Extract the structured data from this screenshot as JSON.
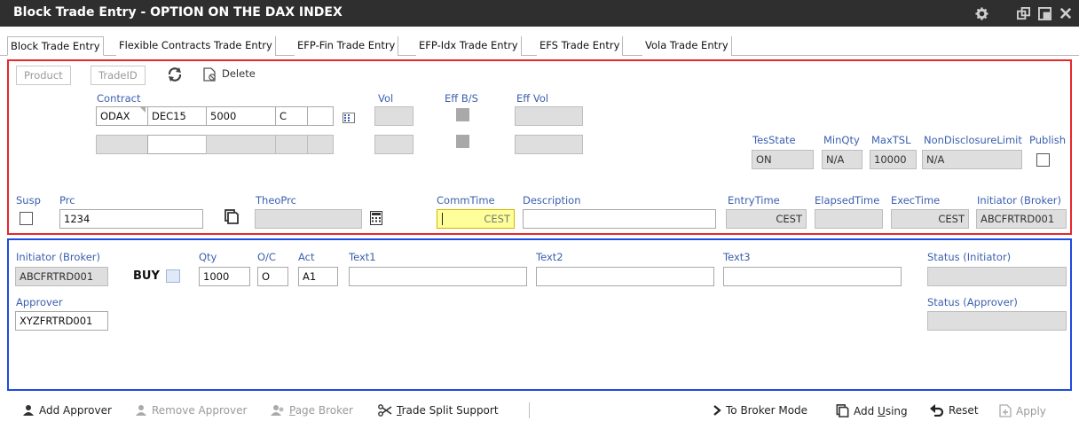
{
  "window": {
    "title": "Block Trade Entry - OPTION ON THE DAX INDEX",
    "icons": [
      "gear-icon",
      "restore-icon",
      "maximize-icon",
      "close-icon"
    ]
  },
  "tabs": [
    {
      "label": "Block Trade Entry",
      "active": true
    },
    {
      "label": "Flexible Contracts Trade Entry",
      "active": false
    },
    {
      "label": "EFP-Fin Trade Entry",
      "active": false
    },
    {
      "label": "EFP-Idx Trade Entry",
      "active": false
    },
    {
      "label": "EFS Trade Entry",
      "active": false
    },
    {
      "label": "Vola Trade Entry",
      "active": false
    }
  ],
  "header_section": {
    "product_btn": "Product",
    "tradeid_btn": "TradeID",
    "delete_btn": "Delete",
    "contract_label": "Contract",
    "contract": {
      "product": "ODAX",
      "expiry": "DEC15",
      "strike": "5000",
      "type": "C",
      "extra": ""
    },
    "vol_label": "Vol",
    "effbs_label": "Eff B/S",
    "effvol_label": "Eff Vol",
    "tesstate_label": "TesState",
    "tesstate_value": "ON",
    "minqty_label": "MinQty",
    "minqty_value": "N/A",
    "maxtsl_label": "MaxTSL",
    "maxtsl_value": "10000",
    "nondisclosure_label": "NonDisclosureLimit",
    "nondisclosure_value": "N/A",
    "publish_label": "Publish",
    "susp_label": "Susp",
    "prc_label": "Prc",
    "prc_value": "1234",
    "theoprc_label": "TheoPrc",
    "commtime_label": "CommTime",
    "commtime_value": "CEST",
    "description_label": "Description",
    "entrytime_label": "EntryTime",
    "entrytime_value": "CEST",
    "elapsedtime_label": "ElapsedTime",
    "exectime_label": "ExecTime",
    "exectime_value": "CEST",
    "initiator_label": "Initiator (Broker)",
    "initiator_value": "ABCFRTRD001"
  },
  "trade_section": {
    "initiator_label": "Initiator (Broker)",
    "initiator_value": "ABCFRTRD001",
    "side_label": "BUY",
    "qty_label": "Qty",
    "qty_value": "1000",
    "oc_label": "O/C",
    "oc_value": "O",
    "act_label": "Act",
    "act_value": "A1",
    "text1_label": "Text1",
    "text2_label": "Text2",
    "text3_label": "Text3",
    "status_initiator_label": "Status (Initiator)",
    "approver_label": "Approver",
    "approver_value": "XYZFRTRD001",
    "status_approver_label": "Status (Approver)"
  },
  "bottom_bar": {
    "add_approver": "Add Approver",
    "remove_approver": "Remove Approver",
    "page_broker": "Page Broker",
    "trade_split_support": "Trade Split Support",
    "to_broker_mode": "To Broker Mode",
    "add_using": "Add Using",
    "reset": "Reset",
    "apply": "Apply"
  },
  "colors": {
    "red_frame": "#e8262b",
    "blue_frame": "#1f4ae3",
    "label_blue": "#3a5fae",
    "titlebar": "#2f2f2f",
    "highlight": "#ffff99"
  }
}
